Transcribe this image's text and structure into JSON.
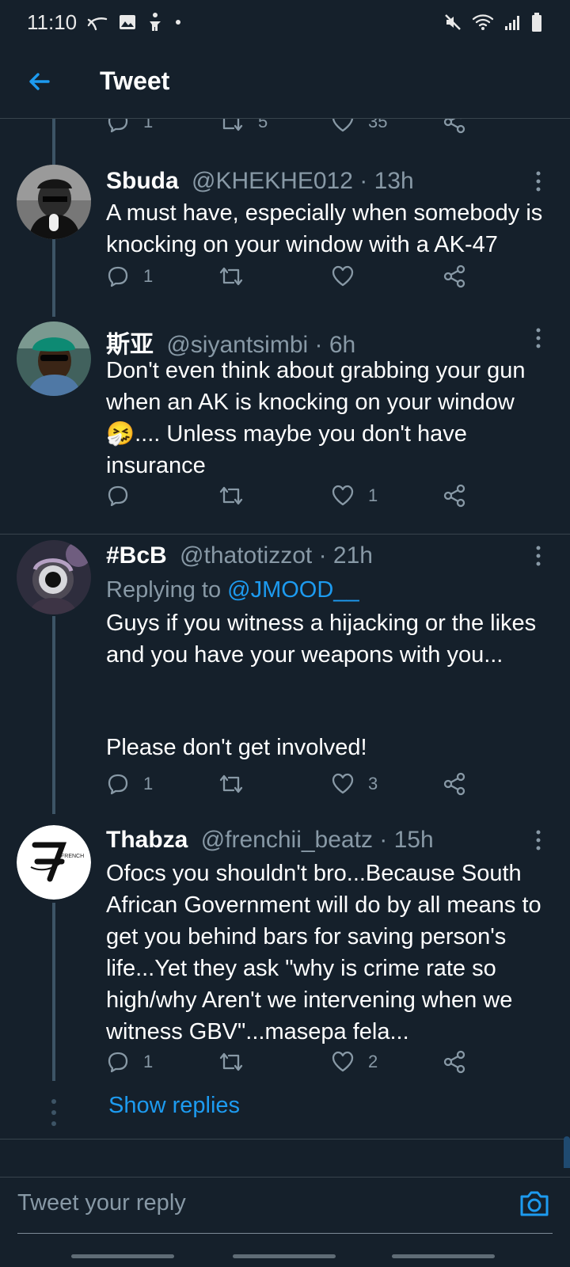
{
  "status": {
    "time": "11:10"
  },
  "header": {
    "title": "Tweet"
  },
  "partial_actions": {
    "reply_count": "1",
    "retweet_count": "5",
    "like_count": "35"
  },
  "tweets": [
    {
      "name": "Sbuda",
      "handle": "@KHEKHE012",
      "time": "· 13h",
      "text": "A must have, especially when somebody is knocking on your window with a AK-47",
      "reply_count": "1",
      "retweet_count": "",
      "like_count": ""
    },
    {
      "name": "斯亚",
      "handle": "@siyantsimbi",
      "time": "· 6h",
      "text_before_emoji": "Don't even think about grabbing your gun when an AK is knocking on your window",
      "emoji": "🤧",
      "text_after_emoji": ".... Unless maybe you don't have insurance",
      "reply_count": "",
      "retweet_count": "",
      "like_count": "1"
    },
    {
      "name": "#BcB",
      "handle": "@thatotizzot",
      "time": "· 21h",
      "replying_prefix": "Replying to",
      "replying_handle": "@JMOOD__",
      "text_line1": "Guys if you witness a hijacking or the likes and you have your weapons with you...",
      "text_line2": "Please don't get involved!",
      "reply_count": "1",
      "retweet_count": "",
      "like_count": "3"
    },
    {
      "name": "Thabza",
      "handle": "@frenchii_beatz",
      "time": "· 15h",
      "text": "Ofocs you shouldn't bro...Because South African Government will do by all means to get you behind bars for saving person's life...Yet they ask \"why is crime rate so high/why Aren't we intervening when we witness GBV\"...masepa fela...",
      "reply_count": "1",
      "retweet_count": "",
      "like_count": "2"
    }
  ],
  "show_replies": "Show replies",
  "reply_bar": {
    "placeholder": "Tweet your reply"
  },
  "colors": {
    "background": "#15202b",
    "accent": "#1d9bf0",
    "muted": "#8899a6",
    "divider": "#38444d",
    "text": "#ffffff"
  },
  "icons": {
    "status": [
      "muted-speaker-icon",
      "wifi-icon",
      "cellular-signal-icon",
      "battery-icon"
    ],
    "tweet_actions": [
      "reply-icon",
      "retweet-icon",
      "like-icon",
      "share-icon"
    ],
    "header": "back-arrow-icon",
    "reply": "camera-icon"
  }
}
